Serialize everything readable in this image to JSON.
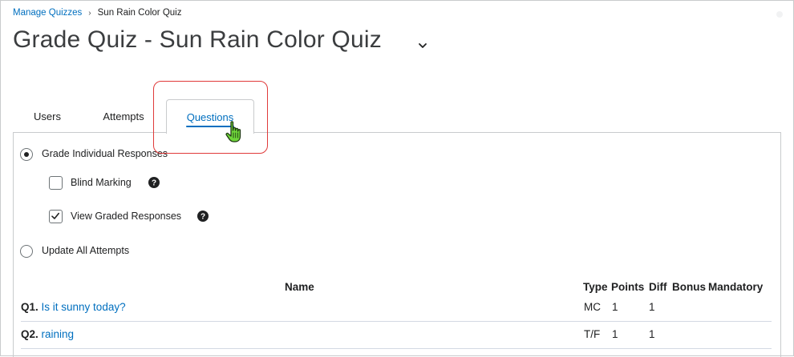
{
  "breadcrumb": {
    "parent": "Manage Quizzes",
    "separator": "›",
    "current": "Sun Rain Color Quiz"
  },
  "page": {
    "title": "Grade Quiz - Sun Rain Color Quiz"
  },
  "tabs": [
    {
      "label": "Users",
      "selected": false
    },
    {
      "label": "Attempts",
      "selected": false
    },
    {
      "label": "Questions",
      "selected": true
    }
  ],
  "options": {
    "grade_individual": {
      "label": "Grade Individual Responses",
      "checked": true
    },
    "blind_marking": {
      "label": "Blind Marking",
      "checked": false
    },
    "view_graded": {
      "label": "View Graded Responses",
      "checked": true
    },
    "update_all": {
      "label": "Update All Attempts",
      "checked": false
    }
  },
  "table": {
    "headers": {
      "name": "Name",
      "type": "Type",
      "points": "Points",
      "diff": "Diff",
      "bonus": "Bonus",
      "mandatory": "Mandatory"
    },
    "rows": [
      {
        "num": "Q1.",
        "name": "Is it sunny today?",
        "type": "MC",
        "points": "1",
        "diff": "1"
      },
      {
        "num": "Q2.",
        "name": "raining",
        "type": "T/F",
        "points": "1",
        "diff": "1"
      }
    ]
  },
  "colors": {
    "link": "#006fbf",
    "highlight": "#e03a3a",
    "cursor": "#6fd63a"
  }
}
